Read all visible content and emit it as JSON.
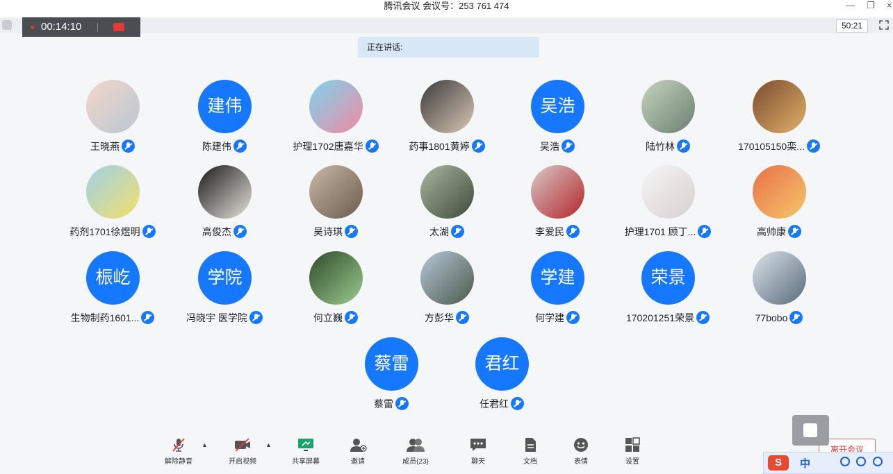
{
  "window": {
    "title": "腾讯会议 会议号：253 761 474",
    "minimize_icon": "minimize-icon",
    "restore_icon": "restore-icon",
    "close_icon": "close-icon"
  },
  "recording": {
    "elapsed": "00:14:10"
  },
  "timer": "50:21",
  "speaking_label": "正在讲话:",
  "colors": {
    "accent": "#1677ff",
    "record_red": "#e53935",
    "leave_red": "#d33"
  },
  "participants": [
    {
      "name": "王晓燕",
      "avatar_text": "",
      "mic": "muted"
    },
    {
      "name": "陈建伟",
      "avatar_text": "建伟",
      "mic": "muted"
    },
    {
      "name": "护理1702唐嘉华",
      "avatar_text": "",
      "mic": "muted"
    },
    {
      "name": "药事1801黄婷",
      "avatar_text": "",
      "mic": "muted"
    },
    {
      "name": "吴浩",
      "avatar_text": "吴浩",
      "mic": "on"
    },
    {
      "name": "陆竹林",
      "avatar_text": "",
      "mic": "muted"
    },
    {
      "name": "170105150栾...",
      "avatar_text": "",
      "mic": "muted"
    },
    {
      "name": "药剂1701徐煜明",
      "avatar_text": "",
      "mic": "muted"
    },
    {
      "name": "高俊杰",
      "avatar_text": "",
      "mic": "muted"
    },
    {
      "name": "吴诗琪",
      "avatar_text": "",
      "mic": "phone"
    },
    {
      "name": "太湖",
      "avatar_text": "",
      "mic": "muted"
    },
    {
      "name": "李爱民",
      "avatar_text": "",
      "mic": "muted"
    },
    {
      "name": "护理1701 顾丁...",
      "avatar_text": "",
      "mic": "muted"
    },
    {
      "name": "高帅康",
      "avatar_text": "",
      "mic": "muted"
    },
    {
      "name": "生物制药1601...",
      "avatar_text": "桭屹",
      "mic": "muted"
    },
    {
      "name": "冯晓宇 医学院",
      "avatar_text": "学院",
      "mic": "muted"
    },
    {
      "name": "何立巍",
      "avatar_text": "",
      "mic": "muted"
    },
    {
      "name": "方彭华",
      "avatar_text": "",
      "mic": "muted"
    },
    {
      "name": "何学建",
      "avatar_text": "学建",
      "mic": "muted"
    },
    {
      "name": "170201251荣景",
      "avatar_text": "荣景",
      "mic": "muted"
    },
    {
      "name": "77bobo",
      "avatar_text": "",
      "mic": "muted"
    },
    {
      "name": "蔡雷",
      "avatar_text": "蔡雷",
      "mic": "muted"
    },
    {
      "name": "任君红",
      "avatar_text": "君红",
      "mic": "muted"
    }
  ],
  "toolbar": {
    "unmute": "解除静音",
    "start_video": "开启视频",
    "share_screen": "共享屏幕",
    "invite": "邀请",
    "members": "成员(23)",
    "chat": "聊天",
    "docs": "文档",
    "reactions": "表情",
    "settings": "设置",
    "leave": "离开会议"
  },
  "ime": {
    "logo": "S",
    "mode": "中"
  }
}
